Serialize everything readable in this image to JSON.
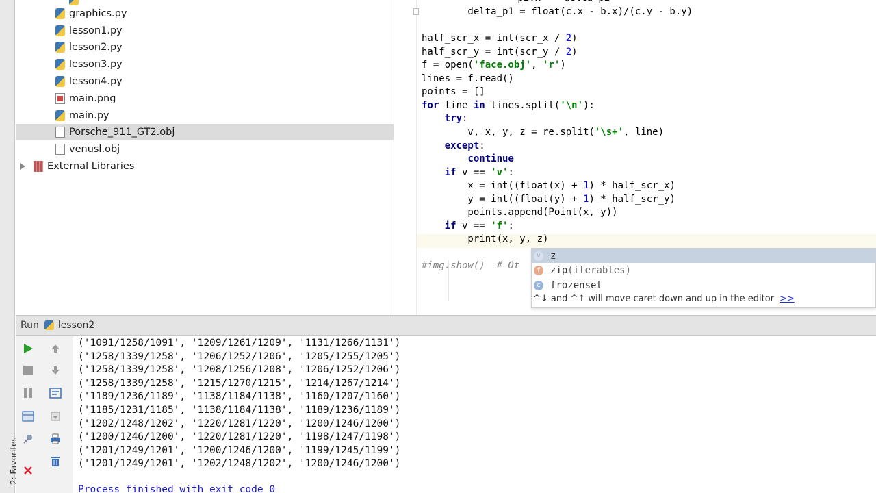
{
  "sidebar": {
    "favorites_label": "2: Favorites"
  },
  "project_tree": {
    "items": [
      {
        "label": "graphics.py",
        "icon": "python-file-icon"
      },
      {
        "label": "lesson1.py",
        "icon": "python-file-icon"
      },
      {
        "label": "lesson2.py",
        "icon": "python-file-icon"
      },
      {
        "label": "lesson3.py",
        "icon": "python-file-icon"
      },
      {
        "label": "lesson4.py",
        "icon": "python-file-icon"
      },
      {
        "label": "main.png",
        "icon": "image-file-icon"
      },
      {
        "label": "main.py",
        "icon": "python-file-icon"
      },
      {
        "label": "Porsche_911_GT2.obj",
        "icon": "text-file-icon",
        "selected": true
      },
      {
        "label": "venusl.obj",
        "icon": "text-file-icon"
      }
    ],
    "external_libraries": "External Libraries"
  },
  "editor": {
    "lines": [
      "        delta_p1 = float(c.x - b.x)/(c.y - b.y)",
      "",
      "half_scr_x = int(scr_x / 2)",
      "half_scr_y = int(scr_y / 2)",
      "f = open('face.obj', 'r')",
      "lines = f.read()",
      "points = []",
      "for line in lines.split('\\n'):",
      "    try:",
      "        v, x, y, z = re.split('\\s+', line)",
      "    except:",
      "        continue",
      "    if v == 'v':",
      "        x = int((float(x) + 1) * half_scr_x)",
      "        y = int((float(y) + 1) * half_scr_y)",
      "        points.append(Point(x, y))",
      "    if v == 'f':",
      "        print(x, y, z)",
      "",
      "#img.show()  # Ot"
    ]
  },
  "completion": {
    "items": [
      {
        "name": "z",
        "signature": "",
        "kind": "v",
        "icon": "variable-icon"
      },
      {
        "name": "zip",
        "signature": "(iterables)",
        "kind": "f",
        "icon": "function-icon"
      },
      {
        "name": "frozenset",
        "signature": "",
        "kind": "c",
        "icon": "class-icon"
      }
    ],
    "hint": "^↓ and ^↑ will move caret down and up in the editor",
    "hint_link": ">>"
  },
  "run_panel": {
    "title": "Run",
    "config_name": "lesson2",
    "output_lines": [
      "('1091/1258/1091', '1209/1261/1209', '1131/1266/1131')",
      "('1258/1339/1258', '1206/1252/1206', '1205/1255/1205')",
      "('1258/1339/1258', '1208/1256/1208', '1206/1252/1206')",
      "('1258/1339/1258', '1215/1270/1215', '1214/1267/1214')",
      "('1189/1236/1189', '1138/1184/1138', '1160/1207/1160')",
      "('1185/1231/1185', '1138/1184/1138', '1189/1236/1189')",
      "('1202/1248/1202', '1220/1281/1220', '1200/1246/1200')",
      "('1200/1246/1200', '1220/1281/1220', '1198/1247/1198')",
      "('1201/1249/1201', '1200/1246/1200', '1199/1245/1199')",
      "('1201/1249/1201', '1202/1248/1202', '1200/1246/1200')"
    ],
    "exit_message": "Process finished with exit code 0"
  },
  "colors": {
    "keyword": "#000080",
    "string": "#008000",
    "number": "#0000ff",
    "selection": "#dcdcdc",
    "completion_selected": "#c6d2e0"
  }
}
